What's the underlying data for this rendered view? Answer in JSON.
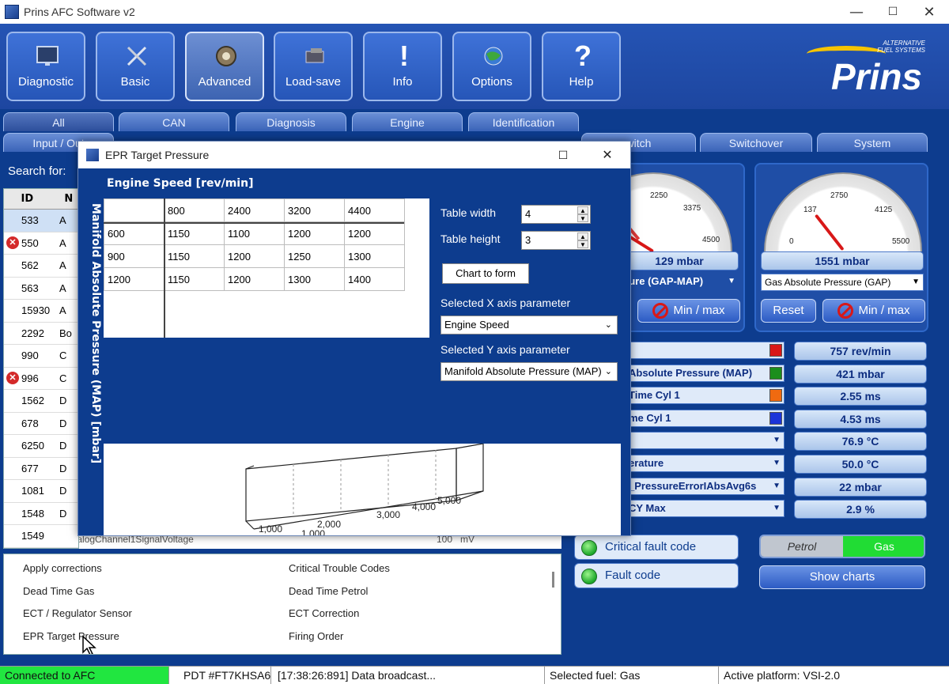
{
  "window": {
    "title": "Prins AFC Software v2",
    "minimize": "—",
    "maximize": "☐",
    "close": "✕"
  },
  "toolbar": {
    "buttons": [
      {
        "label": "Diagnostic",
        "icon": "monitor-icon"
      },
      {
        "label": "Basic",
        "icon": "tools-icon"
      },
      {
        "label": "Advanced",
        "icon": "gear-icon"
      },
      {
        "label": "Load-save",
        "icon": "floppy-icon"
      },
      {
        "label": "Info",
        "icon": "exclamation-icon"
      },
      {
        "label": "Options",
        "icon": "globe-icon"
      },
      {
        "label": "Help",
        "icon": "question-icon"
      }
    ],
    "logo_tag_line1": "ALTERNATIVE",
    "logo_tag_line2": "FUEL SYSTEMS",
    "logo_brand": "Prins"
  },
  "tabs_row1": [
    "All",
    "CAN",
    "Diagnosis",
    "Engine",
    "Identification"
  ],
  "tabs_row2": [
    "Input / Out",
    "witch",
    "Switchover",
    "System"
  ],
  "search": {
    "label": "Search for:"
  },
  "idtable": {
    "headers": {
      "id": "ID",
      "name": "N"
    },
    "rows": [
      {
        "id": "533",
        "name": "A",
        "error": false
      },
      {
        "id": "550",
        "name": "A",
        "error": true
      },
      {
        "id": "562",
        "name": "A",
        "error": false
      },
      {
        "id": "563",
        "name": "A",
        "error": false
      },
      {
        "id": "15930",
        "name": "A",
        "error": false
      },
      {
        "id": "2292",
        "name": "Bo",
        "error": false
      },
      {
        "id": "990",
        "name": "C",
        "error": false
      },
      {
        "id": "996",
        "name": "C",
        "error": true
      },
      {
        "id": "1562",
        "name": "D",
        "error": false
      },
      {
        "id": "678",
        "name": "D",
        "error": false
      },
      {
        "id": "6250",
        "name": "D",
        "error": false
      },
      {
        "id": "677",
        "name": "D",
        "error": false
      },
      {
        "id": "1081",
        "name": "D",
        "error": false
      },
      {
        "id": "1548",
        "name": "D",
        "error": false
      },
      {
        "id": "1549",
        "name": "DiagnosisAnalogChannel1SignalVoltage",
        "error": false
      }
    ],
    "back_row_value": "100",
    "back_row_unit": "mV"
  },
  "bottom_list": {
    "left": [
      "Apply corrections",
      "Dead Time Gas",
      "ECT / Regulator Sensor",
      "EPR Target Pressure"
    ],
    "right": [
      "Critical Trouble Codes",
      "Dead Time Petrol",
      "ECT Correction",
      "Firing Order"
    ]
  },
  "status": {
    "connection": "Connected to AFC",
    "pdt": "PDT #FT7KHSA6",
    "log": "[17:38:26:891] Data broadcast...",
    "fuel": "Selected fuel: Gas",
    "platform": "Active platform: VSI-2.0"
  },
  "gauge_left": {
    "ticks": [
      "2250",
      "3375",
      "4500"
    ],
    "value": "129 mbar",
    "select": "sure (GAP-MAP)",
    "minmax_label": "Min / max"
  },
  "gauge_right": {
    "ticks": [
      "137",
      "2750",
      "4125",
      "0",
      "5500"
    ],
    "value": "1551 mbar",
    "select": "Gas Absolute Pressure (GAP)",
    "reset_label": "Reset",
    "minmax_label": "Min / max"
  },
  "params": [
    {
      "label": "",
      "value": "757 rev/min",
      "swatch": "#d81818",
      "kind": "swatch"
    },
    {
      "label": "Absolute Pressure (MAP)",
      "value": "421 mbar",
      "swatch": "#1c8e1c",
      "kind": "swatch"
    },
    {
      "label": "Time Cyl 1",
      "value": "2.55 ms",
      "swatch": "#f06a10",
      "kind": "swatch"
    },
    {
      "label": "me Cyl 1",
      "value": "4.53 ms",
      "swatch": "#1c34d8",
      "kind": "swatch"
    },
    {
      "label": "",
      "value": "76.9 °C",
      "kind": "drop"
    },
    {
      "label": "erature",
      "value": "50.0 °C",
      "kind": "drop"
    },
    {
      "label": "_PressureErrorIAbsAvg6s",
      "value": "22 mbar",
      "kind": "drop"
    },
    {
      "label": "CY Max",
      "value": "2.9 %",
      "kind": "drop"
    }
  ],
  "faults": {
    "critical": "Critical fault code",
    "fault": "Fault code"
  },
  "fuel_selector": {
    "petrol": "Petrol",
    "gas": "Gas"
  },
  "show_charts": "Show charts",
  "dialog": {
    "title": "EPR Target Pressure",
    "x_axis_title": "Engine Speed [rev/min]",
    "y_axis_title": "Manifold Absolute Pressure (MAP) [mbar]",
    "table_width_label": "Table width",
    "table_width_value": "4",
    "table_height_label": "Table height",
    "table_height_value": "3",
    "chart_to_form": "Chart to form",
    "x_param_label": "Selected X axis parameter",
    "x_param_value": "Engine Speed",
    "y_param_label": "Selected Y axis parameter",
    "y_param_value": "Manifold Absolute Pressure (MAP)",
    "grid": {
      "x_headers": [
        "800",
        "2400",
        "3200",
        "4400"
      ],
      "rows": [
        {
          "y": "600",
          "values": [
            "1150",
            "1100",
            "1200",
            "1200"
          ]
        },
        {
          "y": "900",
          "values": [
            "1150",
            "1200",
            "1250",
            "1300"
          ]
        },
        {
          "y": "1200",
          "values": [
            "1150",
            "1200",
            "1300",
            "1400"
          ]
        }
      ]
    },
    "chart_ticks": [
      "1,000",
      "2,000",
      "3,000",
      "4,000",
      "5,000",
      "1,000",
      "1,000"
    ]
  }
}
